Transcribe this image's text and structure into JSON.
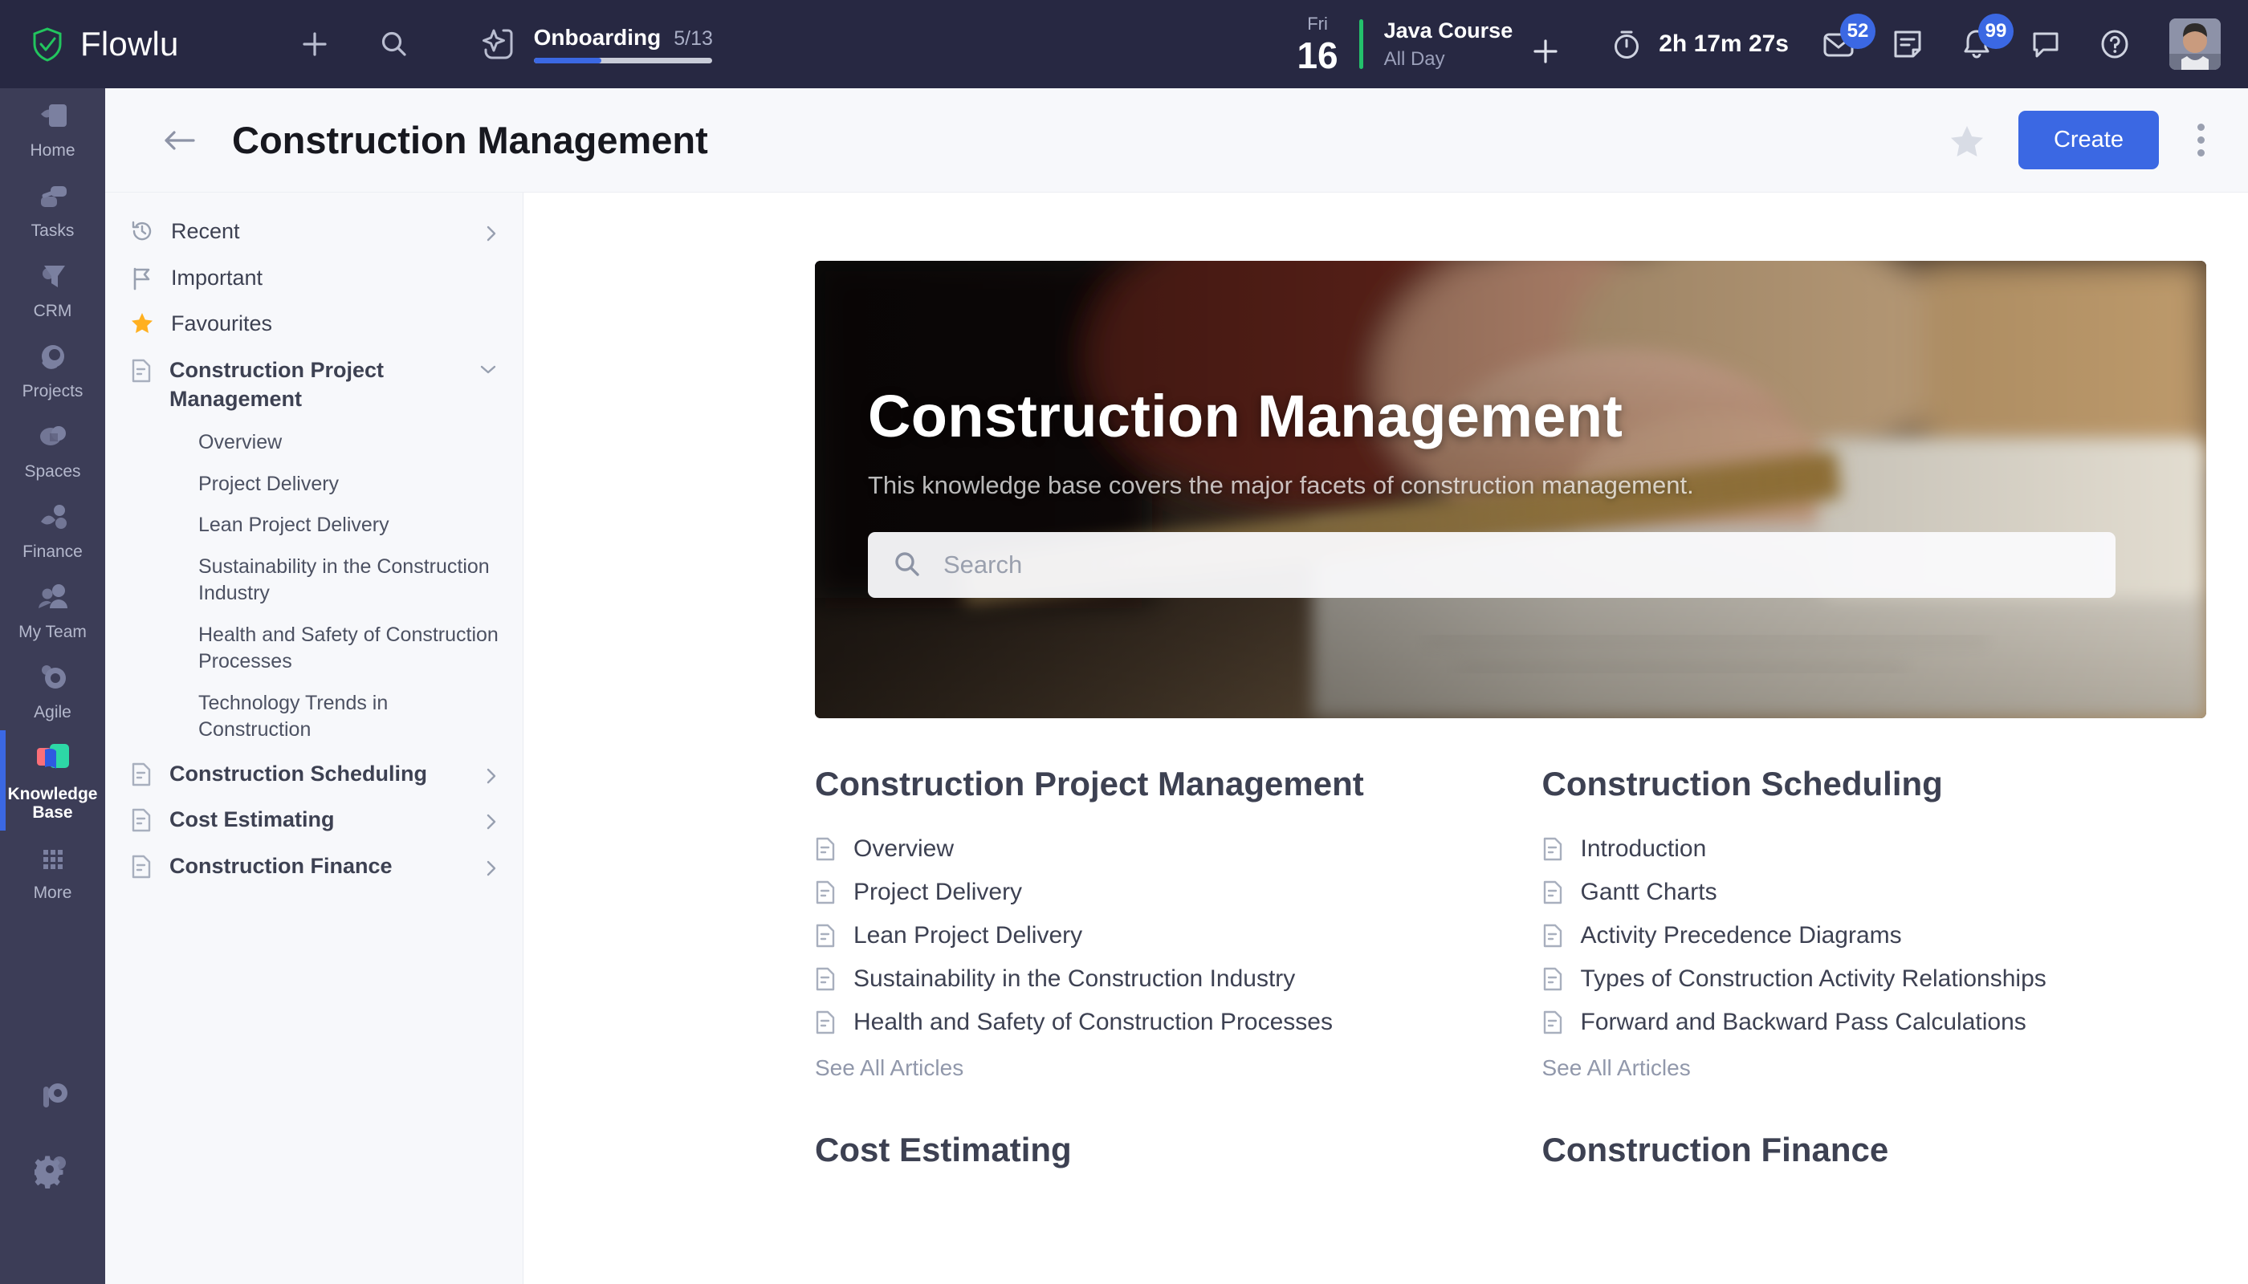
{
  "topbar": {
    "brand": "Flowlu",
    "add_icon": "plus-icon",
    "search_icon": "search-icon",
    "onboarding": {
      "icon": "sparkle-icon",
      "label": "Onboarding",
      "count": "5/13",
      "progress_percent": 38
    },
    "date": {
      "dow": "Fri",
      "day": "16"
    },
    "event": {
      "title": "Java Course",
      "subtitle": "All Day",
      "add_icon": "plus-icon"
    },
    "timer": {
      "icon": "stopwatch-icon",
      "value": "2h 17m 27s"
    },
    "icons": [
      {
        "name": "mail-icon",
        "badge": "52"
      },
      {
        "name": "notes-icon",
        "badge": ""
      },
      {
        "name": "bell-icon",
        "badge": "99"
      },
      {
        "name": "chat-icon",
        "badge": ""
      },
      {
        "name": "help-icon",
        "badge": ""
      }
    ],
    "avatar": "user-avatar"
  },
  "rail": {
    "items": [
      {
        "label": "Home",
        "icon": "home-icon",
        "active": false
      },
      {
        "label": "Tasks",
        "icon": "tasks-icon",
        "active": false
      },
      {
        "label": "CRM",
        "icon": "crm-icon",
        "active": false
      },
      {
        "label": "Projects",
        "icon": "projects-icon",
        "active": false
      },
      {
        "label": "Spaces",
        "icon": "spaces-icon",
        "active": false
      },
      {
        "label": "Finance",
        "icon": "finance-icon",
        "active": false
      },
      {
        "label": "My Team",
        "icon": "team-icon",
        "active": false
      },
      {
        "label": "Agile",
        "icon": "agile-icon",
        "active": false
      },
      {
        "label": "Knowledge Base",
        "icon": "knowledge-base-icon",
        "active": true
      },
      {
        "label": "More",
        "icon": "grid-more-icon",
        "active": false
      }
    ],
    "bottom": [
      {
        "label": "",
        "icon": "portal-icon"
      },
      {
        "label": "",
        "icon": "settings-gear-icon"
      }
    ]
  },
  "subnav": {
    "items": [
      {
        "label": "Recent",
        "icon": "history-icon",
        "chevron": "right",
        "bold": false,
        "children": []
      },
      {
        "label": "Important",
        "icon": "flag-icon",
        "chevron": "",
        "bold": false,
        "children": []
      },
      {
        "label": "Favourites",
        "icon": "star-icon",
        "chevron": "",
        "bold": false,
        "children": []
      },
      {
        "label": "Construction Project Management",
        "icon": "document-icon",
        "chevron": "down",
        "bold": true,
        "children": [
          "Overview",
          "Project Delivery",
          "Lean Project Delivery",
          "Sustainability in the Construction Industry",
          "Health and Safety of Construction Processes",
          "Technology Trends in Construction"
        ]
      },
      {
        "label": "Construction Scheduling",
        "icon": "document-icon",
        "chevron": "right",
        "bold": true,
        "children": []
      },
      {
        "label": "Cost Estimating",
        "icon": "document-icon",
        "chevron": "right",
        "bold": true,
        "children": []
      },
      {
        "label": "Construction Finance",
        "icon": "document-icon",
        "chevron": "right",
        "bold": true,
        "children": []
      }
    ]
  },
  "page_header": {
    "back_icon": "back-arrow-icon",
    "title": "Construction Management",
    "star_icon": "star-outline-icon",
    "create_label": "Create",
    "more_icon": "kebab-menu-icon"
  },
  "hero": {
    "title": "Construction Management",
    "subtitle": "This knowledge base covers the major facets of construction management.",
    "search_placeholder": "Search",
    "search_value": "",
    "search_icon": "search-icon",
    "image": "blurred-photo-hands-ruler-blueprint"
  },
  "sections": [
    {
      "title": "Construction Project Management",
      "articles": [
        "Overview",
        "Project Delivery",
        "Lean Project Delivery",
        "Sustainability in the Construction Industry",
        "Health and Safety of Construction Processes"
      ],
      "see_all": "See All Articles"
    },
    {
      "title": "Construction Scheduling",
      "articles": [
        "Introduction",
        "Gantt Charts",
        "Activity Precedence Diagrams",
        "Types of Construction Activity Relationships",
        "Forward and Backward Pass Calculations"
      ],
      "see_all": "See All Articles"
    },
    {
      "title": "Cost Estimating",
      "articles": [],
      "see_all": ""
    },
    {
      "title": "Construction Finance",
      "articles": [],
      "see_all": ""
    }
  ],
  "colors": {
    "topbar_bg": "#272842",
    "rail_bg": "#3C3D57",
    "accent_blue": "#3B68E3",
    "subnav_bg": "#F7F8FB",
    "star_yellow": "#FFB020",
    "event_green": "#23C16B"
  }
}
